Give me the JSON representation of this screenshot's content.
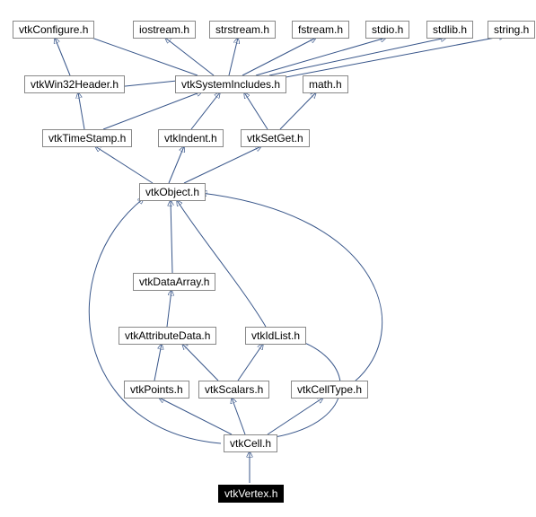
{
  "diagram_type": "include-dependency-graph",
  "nodes": {
    "vtkConfigure": {
      "label": "vtkConfigure.h"
    },
    "iostream": {
      "label": "iostream.h"
    },
    "strstream": {
      "label": "strstream.h"
    },
    "fstream": {
      "label": "fstream.h"
    },
    "stdio": {
      "label": "stdio.h"
    },
    "stdlib": {
      "label": "stdlib.h"
    },
    "string": {
      "label": "string.h"
    },
    "vtkWin32Header": {
      "label": "vtkWin32Header.h"
    },
    "vtkSystemIncludes": {
      "label": "vtkSystemIncludes.h"
    },
    "math": {
      "label": "math.h"
    },
    "vtkTimeStamp": {
      "label": "vtkTimeStamp.h"
    },
    "vtkIndent": {
      "label": "vtkIndent.h"
    },
    "vtkSetGet": {
      "label": "vtkSetGet.h"
    },
    "vtkObject": {
      "label": "vtkObject.h"
    },
    "vtkDataArray": {
      "label": "vtkDataArray.h"
    },
    "vtkAttributeData": {
      "label": "vtkAttributeData.h"
    },
    "vtkIdList": {
      "label": "vtkIdList.h"
    },
    "vtkPoints": {
      "label": "vtkPoints.h"
    },
    "vtkScalars": {
      "label": "vtkScalars.h"
    },
    "vtkCellType": {
      "label": "vtkCellType.h"
    },
    "vtkCell": {
      "label": "vtkCell.h"
    },
    "vtkVertex": {
      "label": "vtkVertex.h"
    }
  },
  "edges": [
    [
      "vtkVertex",
      "vtkCell"
    ],
    [
      "vtkCell",
      "vtkPoints"
    ],
    [
      "vtkCell",
      "vtkScalars"
    ],
    [
      "vtkCell",
      "vtkIdList"
    ],
    [
      "vtkCell",
      "vtkCellType"
    ],
    [
      "vtkCell",
      "vtkObject"
    ],
    [
      "vtkPoints",
      "vtkAttributeData"
    ],
    [
      "vtkScalars",
      "vtkAttributeData"
    ],
    [
      "vtkScalars",
      "vtkIdList"
    ],
    [
      "vtkCellType",
      "vtkObject"
    ],
    [
      "vtkIdList",
      "vtkObject"
    ],
    [
      "vtkAttributeData",
      "vtkDataArray"
    ],
    [
      "vtkDataArray",
      "vtkObject"
    ],
    [
      "vtkObject",
      "vtkTimeStamp"
    ],
    [
      "vtkObject",
      "vtkIndent"
    ],
    [
      "vtkObject",
      "vtkSetGet"
    ],
    [
      "vtkTimeStamp",
      "vtkWin32Header"
    ],
    [
      "vtkTimeStamp",
      "vtkSystemIncludes"
    ],
    [
      "vtkIndent",
      "vtkSystemIncludes"
    ],
    [
      "vtkSetGet",
      "vtkSystemIncludes"
    ],
    [
      "vtkSetGet",
      "math"
    ],
    [
      "vtkWin32Header",
      "vtkConfigure"
    ],
    [
      "vtkSystemIncludes",
      "vtkConfigure"
    ],
    [
      "vtkSystemIncludes",
      "iostream"
    ],
    [
      "vtkSystemIncludes",
      "strstream"
    ],
    [
      "vtkSystemIncludes",
      "fstream"
    ],
    [
      "vtkSystemIncludes",
      "stdio"
    ],
    [
      "vtkSystemIncludes",
      "stdlib"
    ],
    [
      "vtkSystemIncludes",
      "string"
    ],
    [
      "vtkSystemIncludes",
      "vtkWin32Header"
    ]
  ],
  "colors": {
    "edge": "#38568a",
    "nodeBorder": "#888888",
    "rootBg": "#000000",
    "rootFg": "#ffffff"
  }
}
